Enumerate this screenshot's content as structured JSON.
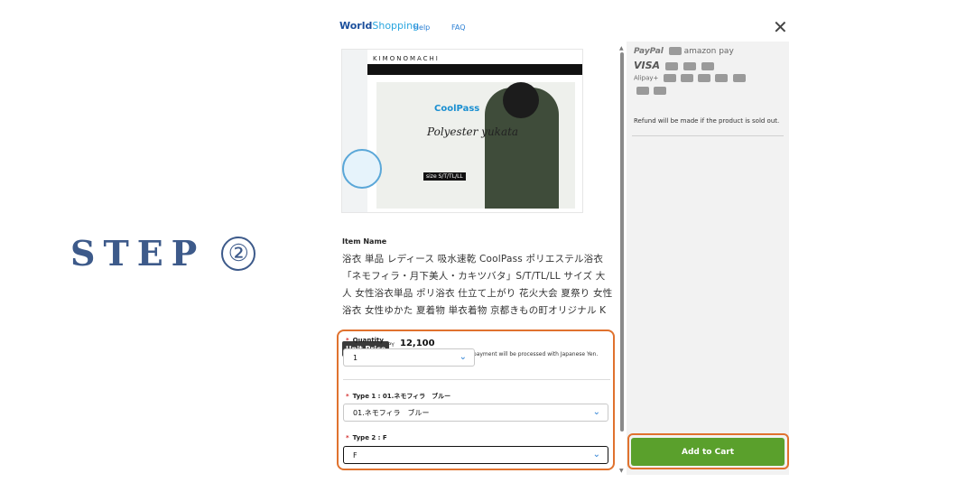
{
  "step": {
    "text": "STEP",
    "number": "②"
  },
  "header": {
    "logo_world": "World",
    "logo_shopping": "Shopping",
    "help_link": "Help",
    "faq_link": "FAQ"
  },
  "product": {
    "image": {
      "brand": "KIMONOMACHI",
      "coolpass": "CoolPass",
      "polyester": "Polyester yukata",
      "size_tag": "size S/T/TL/LL"
    },
    "item_name_label": "Item Name",
    "title": "浴衣 単品 レディース 吸水速乾 CoolPass ポリエステル浴衣「ネモフィラ・月下美人・カキツバタ」S/T/TL/LL サイズ 大人 女性浴衣単品 ポリ浴衣 仕立て上がり 花火大会 夏祭り 女性浴衣 女性ゆかた 夏着物 単衣着物 京都きもの町オリジナル K",
    "unit_price_label": "Unit Price",
    "currency": "JPY",
    "price": "12,100",
    "price_note": "Approximately USD 85.14. Your payment will be processed with Japanese Yen."
  },
  "options": {
    "quantity": {
      "label": "Quantity",
      "value": "1"
    },
    "type1": {
      "label": "Type 1 : 01.ネモフィラ　ブルー",
      "value": "01.ネモフィラ　ブルー"
    },
    "type2": {
      "label": "Type 2 : F",
      "value": "F"
    }
  },
  "payments": {
    "paypal": "PayPal",
    "amazon": "amazon pay",
    "visa": "VISA",
    "alipay": "Alipay+"
  },
  "refund_note": "Refund will be made if the product is sold out.",
  "cart": {
    "button_label": "Add to Cart"
  },
  "colors": {
    "accent_outline": "#e0722e",
    "cart_green": "#5aa02c",
    "step_blue": "#3d5a8a"
  }
}
